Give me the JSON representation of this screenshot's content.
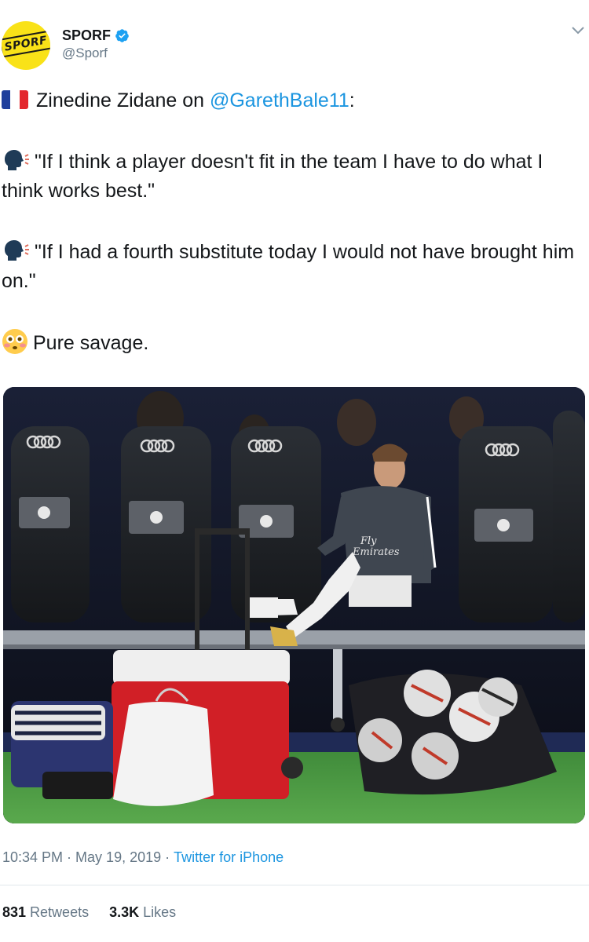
{
  "author": {
    "avatar_logo_text": "SPORF",
    "display_name": "SPORF",
    "handle": "@Sporf",
    "verified": true
  },
  "tweet": {
    "intro_text": "Zinedine Zidane on ",
    "mention": "@GarethBale11",
    "intro_suffix": ":",
    "quote1": "\"If I think a player doesn't fit in the team I have to do what I think works best.\"",
    "quote2": "\"If I had a fourth substitute today I would not have brought him on.\"",
    "closing": "Pure savage.",
    "emojis": [
      "flag-france",
      "speaking-head",
      "speaking-head",
      "flushed-face"
    ]
  },
  "photo": {
    "sponsor_logo": "Audi",
    "shirt_text": "Fly Emirates",
    "scene": "player-on-bench"
  },
  "meta": {
    "time": "10:34 PM",
    "separator": " · ",
    "date": "May 19, 2019",
    "source": "Twitter for iPhone"
  },
  "stats": {
    "retweets_count": "831",
    "retweets_label": "Retweets",
    "likes_count": "3.3K",
    "likes_label": "Likes"
  },
  "colors": {
    "link": "#1b95e0",
    "secondary_text": "#657786",
    "avatar_bg": "#f9e218"
  }
}
